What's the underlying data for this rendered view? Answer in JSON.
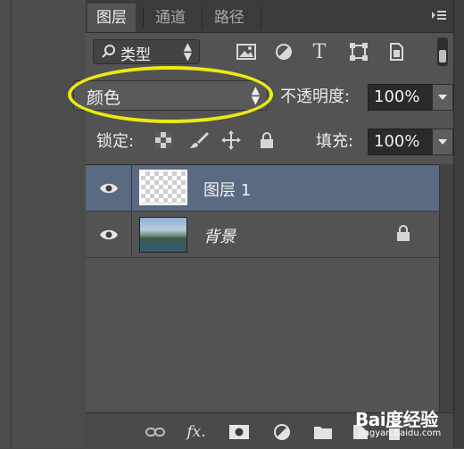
{
  "tabs": [
    {
      "label": "图层",
      "active": true
    },
    {
      "label": "通道",
      "active": false
    },
    {
      "label": "路径",
      "active": false
    }
  ],
  "panel_menu_icon": "panel-menu-icon",
  "filter": {
    "kind_label": "类型",
    "icons": [
      "image-filter-icon",
      "adjustment-filter-icon",
      "type-filter-icon",
      "shape-filter-icon",
      "smart-object-filter-icon"
    ]
  },
  "blend": {
    "mode": "颜色",
    "opacity_label": "不透明度:",
    "opacity_value": "100%"
  },
  "lock": {
    "label": "锁定:",
    "icons": [
      "lock-transparent-pixels-icon",
      "lock-image-pixels-icon",
      "lock-position-icon",
      "lock-all-icon"
    ],
    "fill_label": "填充:",
    "fill_value": "100%"
  },
  "layers": [
    {
      "name": "图层 1",
      "visible": true,
      "selected": true,
      "italic": false,
      "locked": false,
      "thumb": "transparent"
    },
    {
      "name": "背景",
      "visible": true,
      "selected": false,
      "italic": true,
      "locked": true,
      "thumb": "landscape"
    }
  ],
  "bottom_toolbar": [
    "link-layers-icon",
    "fx-icon",
    "add-mask-icon",
    "adjustment-layer-icon",
    "new-group-icon",
    "new-layer-icon",
    "delete-layer-icon"
  ],
  "fx_label": "fx.",
  "watermark": {
    "logo": "Bai度经验",
    "sub": "jingyan.baidu.com"
  },
  "colors": {
    "highlight": "#eaea12",
    "selected_row": "#5a6a80",
    "panel_bg": "#535353"
  }
}
